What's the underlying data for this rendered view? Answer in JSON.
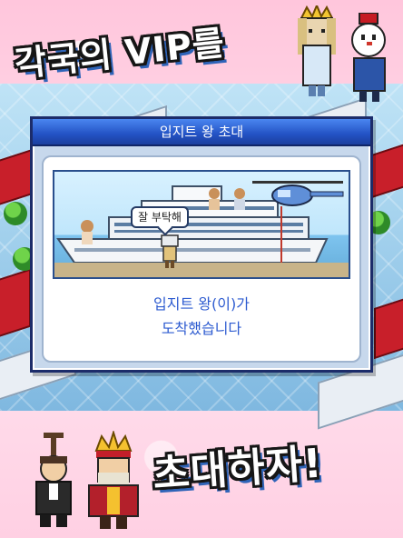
{
  "banner": {
    "top_text": "각국의 VIP를",
    "bottom_text": "초대하자!"
  },
  "dialog": {
    "title": "입지트 왕 초대",
    "speech_bubble": "잘 부탁해",
    "message_line1": "입지트 왕(이)가",
    "message_line2": "도착했습니다"
  },
  "colors": {
    "accent_blue": "#2352c4",
    "message_blue": "#2d5bd0",
    "title_bar_border": "#1c2c6a",
    "background_pink": "#ffd6e8"
  },
  "icons": {
    "cruise_ship": "cruise-ship-icon",
    "helicopter": "helicopter-icon",
    "egypt_king": "egypt-king-icon",
    "queen": "queen-icon",
    "snowman": "snowman-icon",
    "king": "king-icon",
    "butler": "butler-icon"
  }
}
